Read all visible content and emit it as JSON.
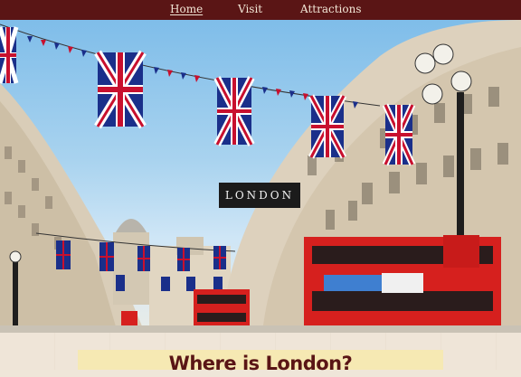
{
  "nav": {
    "items": [
      {
        "label": "Home",
        "active": true
      },
      {
        "label": "Visit",
        "active": false
      },
      {
        "label": "Attractions",
        "active": false
      }
    ]
  },
  "hero": {
    "title": "LONDON"
  },
  "section": {
    "heading": "Where is London?"
  },
  "colors": {
    "nav_bg": "#5a1515",
    "heading": "#5a1515",
    "heading_box": "#f6e9b3",
    "page_bg": "#efe6d9",
    "bus_red": "#d6201e"
  }
}
